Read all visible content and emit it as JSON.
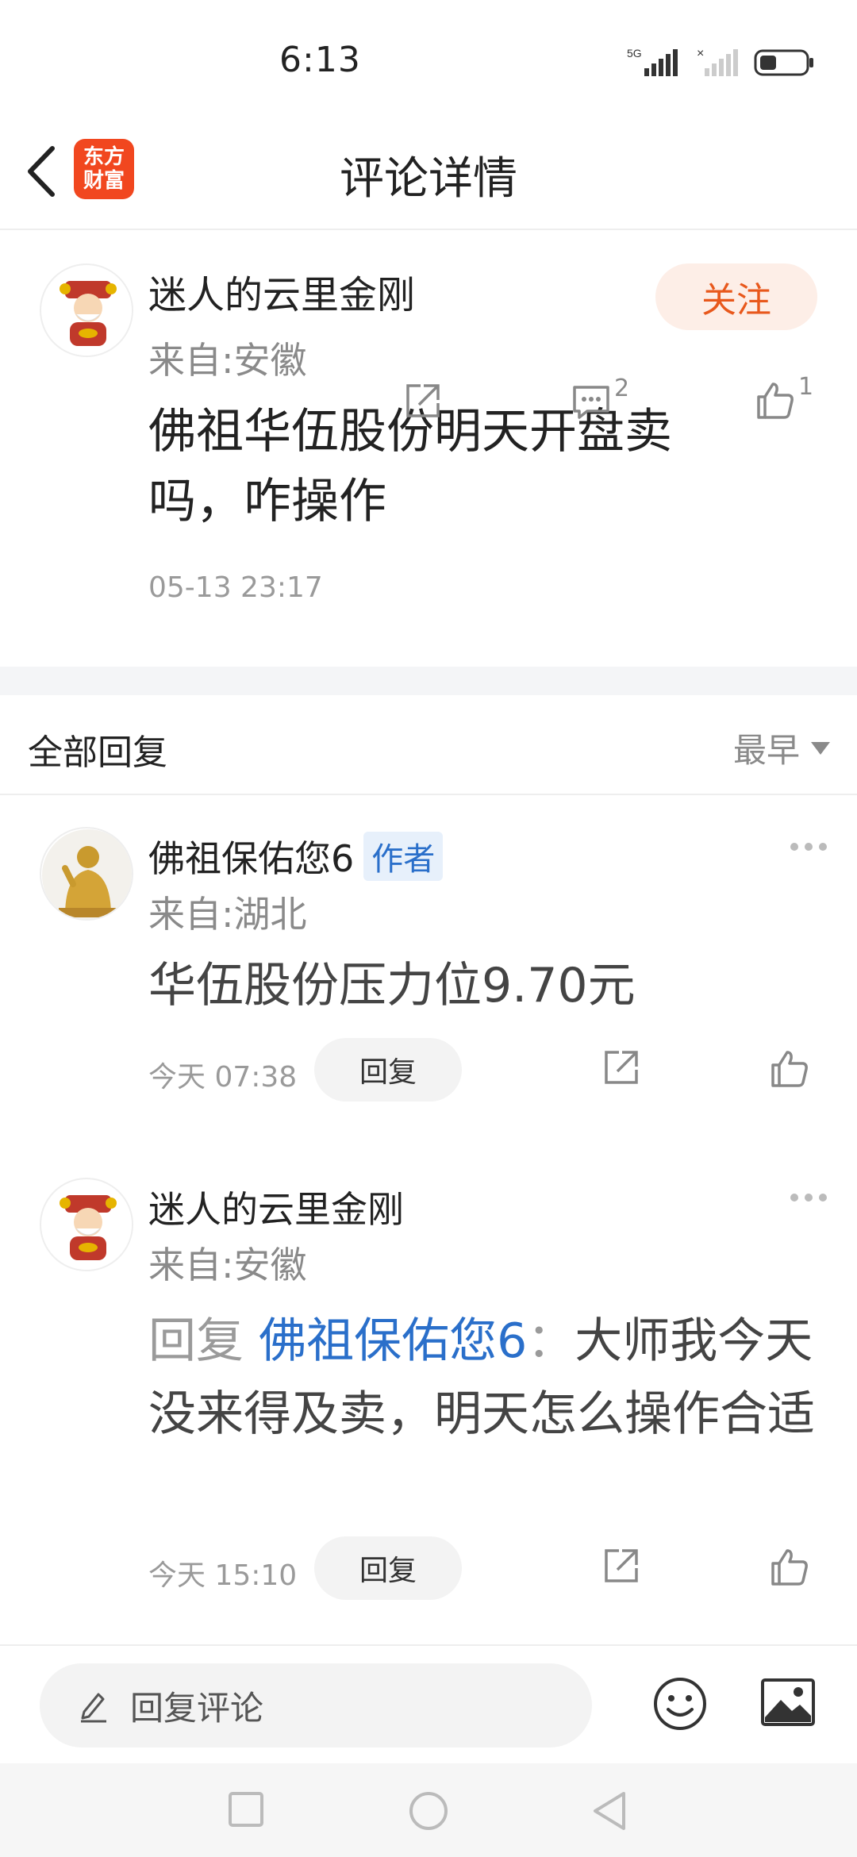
{
  "status_bar": {
    "time": "6:13",
    "network": "5G"
  },
  "header": {
    "title": "评论详情",
    "logo_line1": "东方",
    "logo_line2": "财富"
  },
  "post": {
    "author": "迷人的云里金刚",
    "location": "来自:安徽",
    "follow_label": "关注",
    "content": "佛祖华伍股份明天开盘卖吗，咋操作",
    "time": "05-13 23:17",
    "comment_count": "2",
    "like_count": "1"
  },
  "replies_section": {
    "title": "全部回复",
    "sort_label": "最早"
  },
  "replies": [
    {
      "author": "佛祖保佑您6",
      "tag": "作者",
      "location": "来自:湖北",
      "content": "华伍股份压力位9.70元",
      "time": "今天 07:38",
      "reply_label": "回复"
    },
    {
      "author": "迷人的云里金刚",
      "location": "来自:安徽",
      "prefix": "回复",
      "target": "佛祖保佑您6",
      "separator": "：",
      "content": "大师我今天没来得及卖，明天怎么操作合适",
      "time": "今天 15:10",
      "reply_label": "回复"
    }
  ],
  "bottom_bar": {
    "placeholder": "回复评论"
  },
  "colors": {
    "accent_orange": "#e8581c",
    "link_blue": "#2a6fca",
    "logo_red": "#f1471f"
  }
}
